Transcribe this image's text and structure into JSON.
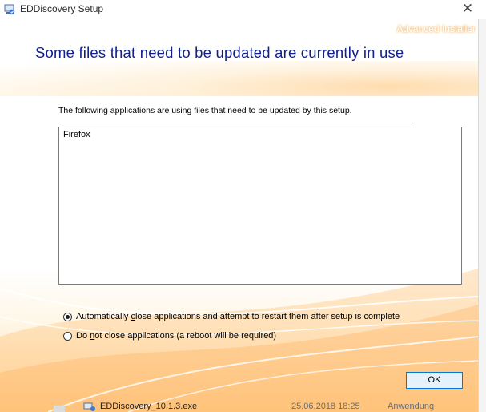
{
  "window": {
    "title": "EDDiscovery Setup",
    "close_glyph": "✕"
  },
  "banner": {
    "brand": "Advanced Installer",
    "heading": "Some files that need to be updated are currently in use"
  },
  "main": {
    "intro": "The following applications are using files that need to be updated by this setup.",
    "applications": [
      "Firefox"
    ],
    "options": [
      {
        "label_pre": "Automatically ",
        "label_u": "c",
        "label_post": "lose applications and attempt to restart them after setup is complete",
        "selected": true
      },
      {
        "label_pre": "Do ",
        "label_u": "n",
        "label_post": "ot close applications (a reboot will be required)",
        "selected": false
      }
    ],
    "ok_label": "OK"
  },
  "background_row": {
    "file_name": "EDDiscovery_10.1.3.exe",
    "date": "25.06.2018 18:25",
    "type": "Anwendung"
  },
  "colors": {
    "heading": "#10218c",
    "accent": "#0078d7",
    "warm": "#ffd9a0"
  },
  "icons": {
    "app": "installer-icon",
    "close": "close-icon"
  }
}
